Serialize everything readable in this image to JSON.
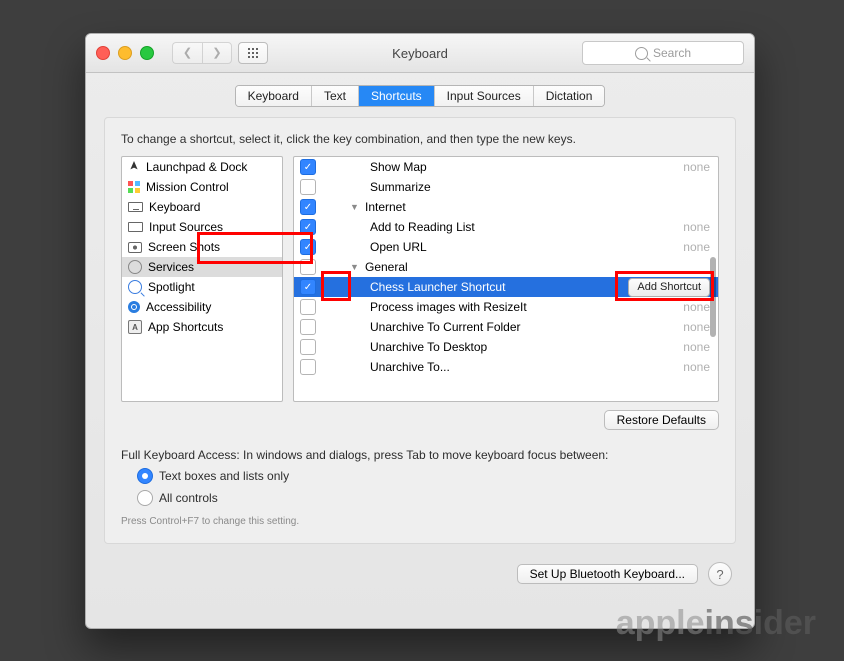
{
  "window": {
    "title": "Keyboard"
  },
  "search": {
    "placeholder": "Search"
  },
  "tabs": [
    "Keyboard",
    "Text",
    "Shortcuts",
    "Input Sources",
    "Dictation"
  ],
  "active_tab_index": 2,
  "panel": {
    "instruction": "To change a shortcut, select it, click the key combination, and then type the new keys."
  },
  "categories": [
    {
      "label": "Launchpad & Dock",
      "icon": "rocket"
    },
    {
      "label": "Mission Control",
      "icon": "grid"
    },
    {
      "label": "Keyboard",
      "icon": "kbd"
    },
    {
      "label": "Input Sources",
      "icon": "flag"
    },
    {
      "label": "Screen Shots",
      "icon": "cam"
    },
    {
      "label": "Services",
      "icon": "gear"
    },
    {
      "label": "Spotlight",
      "icon": "spot"
    },
    {
      "label": "Accessibility",
      "icon": "acc"
    },
    {
      "label": "App Shortcuts",
      "icon": "as"
    }
  ],
  "selected_category_index": 5,
  "shortcuts": [
    {
      "type": "item",
      "indent": 2,
      "checked": true,
      "label": "Show Map",
      "value": "none"
    },
    {
      "type": "item",
      "indent": 2,
      "checked": false,
      "label": "Summarize",
      "value": ""
    },
    {
      "type": "group",
      "indent": 1,
      "checked": true,
      "label": "Internet"
    },
    {
      "type": "item",
      "indent": 2,
      "checked": true,
      "label": "Add to Reading List",
      "value": "none"
    },
    {
      "type": "item",
      "indent": 2,
      "checked": true,
      "label": "Open URL",
      "value": "none"
    },
    {
      "type": "group",
      "indent": 1,
      "checked": false,
      "label": "General"
    },
    {
      "type": "item",
      "indent": 2,
      "checked": true,
      "label": "Chess Launcher Shortcut",
      "value": "Add Shortcut",
      "selected": true,
      "button": true
    },
    {
      "type": "item",
      "indent": 2,
      "checked": false,
      "label": "Process images with ResizeIt",
      "value": "none"
    },
    {
      "type": "item",
      "indent": 2,
      "checked": false,
      "label": "Unarchive To Current Folder",
      "value": "none"
    },
    {
      "type": "item",
      "indent": 2,
      "checked": false,
      "label": "Unarchive To Desktop",
      "value": "none"
    },
    {
      "type": "item",
      "indent": 2,
      "checked": false,
      "label": "Unarchive To...",
      "value": "none"
    }
  ],
  "restore_label": "Restore Defaults",
  "keyboard_access": {
    "heading": "Full Keyboard Access: In windows and dialogs, press Tab to move keyboard focus between:",
    "options": [
      "Text boxes and lists only",
      "All controls"
    ],
    "selected": 0,
    "hint": "Press Control+F7 to change this setting."
  },
  "footer": {
    "bluetooth": "Set Up Bluetooth Keyboard..."
  },
  "watermark": {
    "a": "apple",
    "b": "insider"
  }
}
